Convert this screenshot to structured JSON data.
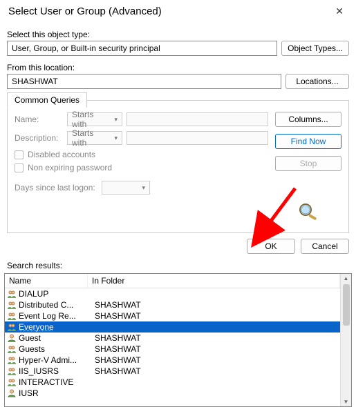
{
  "title": "Select User or Group (Advanced)",
  "object_type": {
    "label": "Select this object type:",
    "value": "User, Group, or Built-in security principal",
    "button": "Object Types..."
  },
  "location": {
    "label": "From this location:",
    "value": "SHASHWAT",
    "button": "Locations..."
  },
  "queries": {
    "tab": "Common Queries",
    "name_label": "Name:",
    "desc_label": "Description:",
    "starts_with": "Starts with",
    "disabled": "Disabled accounts",
    "nonexp": "Non expiring password",
    "days_label": "Days since last logon:"
  },
  "side_buttons": {
    "columns": "Columns...",
    "find_now": "Find Now",
    "stop": "Stop"
  },
  "dialog": {
    "ok": "OK",
    "cancel": "Cancel"
  },
  "results_label": "Search results:",
  "columns": {
    "name": "Name",
    "folder": "In Folder"
  },
  "results": [
    {
      "name": "DIALUP",
      "folder": "",
      "icon": "group"
    },
    {
      "name": "Distributed C...",
      "folder": "SHASHWAT",
      "icon": "group"
    },
    {
      "name": "Event Log Re...",
      "folder": "SHASHWAT",
      "icon": "group"
    },
    {
      "name": "Everyone",
      "folder": "",
      "icon": "group",
      "selected": true
    },
    {
      "name": "Guest",
      "folder": "SHASHWAT",
      "icon": "user"
    },
    {
      "name": "Guests",
      "folder": "SHASHWAT",
      "icon": "group"
    },
    {
      "name": "Hyper-V Admi...",
      "folder": "SHASHWAT",
      "icon": "group"
    },
    {
      "name": "IIS_IUSRS",
      "folder": "SHASHWAT",
      "icon": "group"
    },
    {
      "name": "INTERACTIVE",
      "folder": "",
      "icon": "group"
    },
    {
      "name": "IUSR",
      "folder": "",
      "icon": "user"
    }
  ]
}
